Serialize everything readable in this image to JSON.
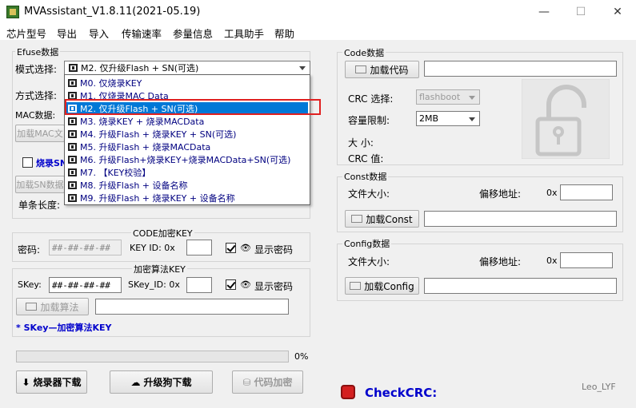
{
  "window": {
    "title": "MVAssistant_V1.8.11(2021-05.19)",
    "minimize": "—",
    "maximize": "☐",
    "close": "✕"
  },
  "menu": [
    "芯片型号",
    "导出",
    "导入",
    "传输速率",
    "参量信息",
    "工具助手",
    "帮助"
  ],
  "efuse": {
    "group_title": "Efuse数据",
    "mode_label": "模式选择:",
    "mode_value": "M2. 仅升级Flash + SN(可选)",
    "method_label": "方式选择:",
    "mac_label": "MAC数据:",
    "load_mac_button": "加载MAC文",
    "burn_sn_label": "烧录SN",
    "load_sn_button": "加载SN数据",
    "item_length_label": "单条长度:",
    "dropdown_options": [
      "M0. 仅烧录KEY",
      "M1. 仅烧录MAC Data",
      "M2. 仅升级Flash + SN(可选)",
      "M3. 烧录KEY + 烧录MACData",
      "M4. 升级Flash + 烧录KEY + SN(可选)",
      "M5. 升级Flash + 烧录MACData",
      "M6. 升级Flash+烧录KEY+烧录MACData+SN(可选)",
      "M7. 【KEY校验】",
      "M8. 升级Flash + 设备名称",
      "M9. 升级Flash + 烧录KEY + 设备名称"
    ],
    "selected_index": 2
  },
  "code_key": {
    "group_title": "CODE加密KEY",
    "password_label": "密码:",
    "password_value": "##-##-##-##",
    "key_id_label": "KEY ID: 0x",
    "show_password_label": "显示密码"
  },
  "algo_key": {
    "group_title": "加密算法KEY",
    "skey_label": "SKey:",
    "skey_value": "##-##-##-##",
    "skey_id_label": "SKey_ID: 0x",
    "show_password_label": "显示密码",
    "load_algo_button": "加载算法",
    "note": "* SKey—加密算法KEY"
  },
  "progress": {
    "value": 0,
    "label": "0%"
  },
  "bottom_buttons": {
    "burner_download": "烧录器下载",
    "upgrade_dongle_download": "升级狗下载",
    "code_encrypt": "代码加密"
  },
  "code_data": {
    "group_title": "Code数据",
    "load_code_button": "加载代码",
    "crc_select_label": "CRC 选择:",
    "crc_select_value": "flashboot",
    "capacity_label": "容量限制:",
    "capacity_value": "2MB",
    "size_label": "大    小:",
    "crc_value_label": "CRC  值:"
  },
  "const_data": {
    "group_title": "Const数据",
    "file_size_label": "文件大小:",
    "offset_label": "偏移地址:",
    "hex_prefix": "0x",
    "load_button": "加载Const"
  },
  "config_data": {
    "group_title": "Config数据",
    "file_size_label": "文件大小:",
    "offset_label": "偏移地址:",
    "hex_prefix": "0x",
    "load_button": "加载Config"
  },
  "status": {
    "check_crc_label": "CheckCRC:",
    "watermark": "Leo_LYF"
  },
  "colors": {
    "accent_blue": "#0078d7",
    "option_text": "#000080",
    "checkcrc": "#0000cc",
    "highlight_red": "#e02020",
    "stop_red": "#d42020"
  }
}
